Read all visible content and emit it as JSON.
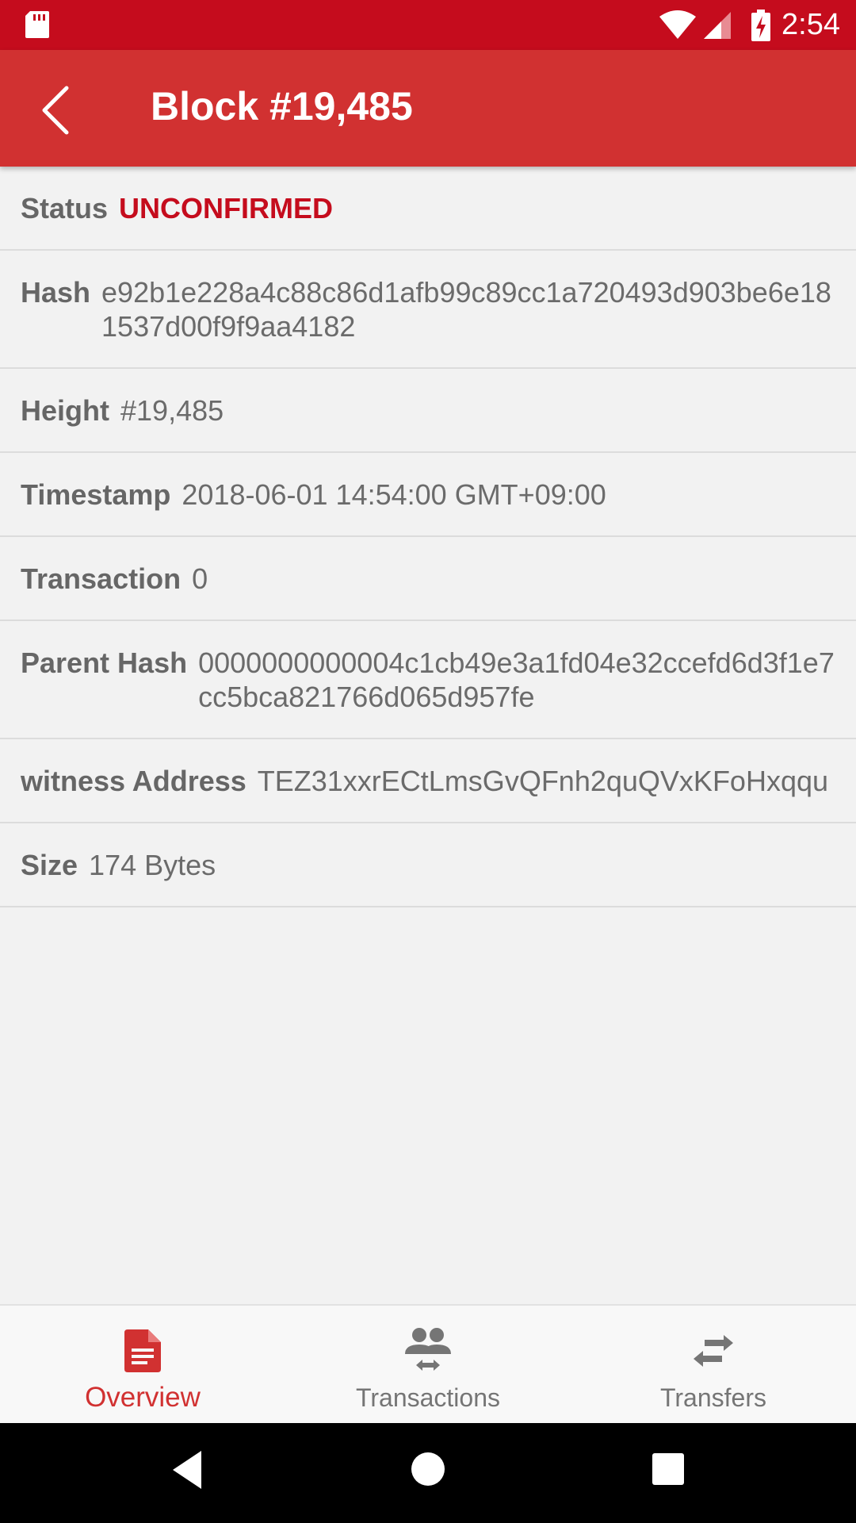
{
  "status_bar": {
    "time": "2:54"
  },
  "app_bar": {
    "title": "Block #19,485"
  },
  "details": [
    {
      "label": "Status",
      "value": "UNCONFIRMED"
    },
    {
      "label": "Hash",
      "value": "e92b1e228a4c88c86d1afb99c89cc1a720493d903be6e181537d00f9f9aa4182"
    },
    {
      "label": "Height",
      "value": "#19,485"
    },
    {
      "label": "Timestamp",
      "value": "2018-06-01 14:54:00 GMT+09:00"
    },
    {
      "label": "Transaction",
      "value": "0"
    },
    {
      "label": "Parent Hash",
      "value": "0000000000004c1cb49e3a1fd04e32ccefd6d3f1e7cc5bca821766d065d957fe"
    },
    {
      "label": "witness Address",
      "value": "TEZ31xxrECtLmsGvQFnh2quQVxKFoHxqqu"
    },
    {
      "label": "Size",
      "value": "174 Bytes"
    }
  ],
  "bottom_nav": {
    "items": [
      {
        "label": "Overview",
        "icon": "document-icon",
        "active": true
      },
      {
        "label": "Transactions",
        "icon": "people-transfer-icon",
        "active": false
      },
      {
        "label": "Transfers",
        "icon": "swap-arrows-icon",
        "active": false
      }
    ]
  },
  "colors": {
    "status_bar": "#c50c1d",
    "app_bar": "#d13131",
    "accent": "#c50c1d",
    "background": "#f2f2f2"
  }
}
